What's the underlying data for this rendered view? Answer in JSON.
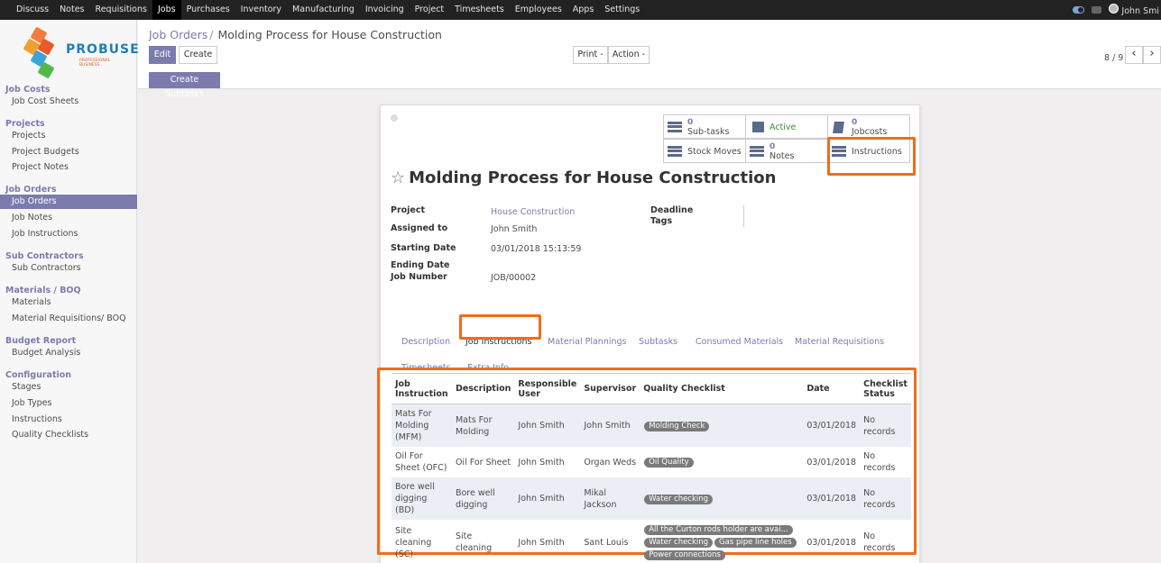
{
  "topnav": {
    "items": [
      "Discuss",
      "Notes",
      "Requisitions",
      "Jobs",
      "Purchases",
      "Inventory",
      "Manufacturing",
      "Invoicing",
      "Project",
      "Timesheets",
      "Employees",
      "Apps",
      "Settings"
    ],
    "active": "Jobs",
    "user": "John Smi"
  },
  "logo": {
    "name": "PROBUSE",
    "tagline": "PROFESSIONAL BUSINESS"
  },
  "sidebar": {
    "sections": [
      {
        "title": "Job Costs",
        "items": [
          "Job Cost Sheets"
        ]
      },
      {
        "title": "Projects",
        "items": [
          "Projects",
          "Project Budgets",
          "Project Notes"
        ]
      },
      {
        "title": "Job Orders",
        "items": [
          "Job Orders",
          "Job Notes",
          "Job Instructions"
        ]
      },
      {
        "title": "Sub Contractors",
        "items": [
          "Sub Contractors"
        ]
      },
      {
        "title": "Materials / BOQ",
        "items": [
          "Materials",
          "Material Requisitions/ BOQ"
        ]
      },
      {
        "title": "Budget Report",
        "items": [
          "Budget Analysis"
        ]
      },
      {
        "title": "Configuration",
        "items": [
          "Stages",
          "Job Types",
          "Instructions",
          "Quality Checklists"
        ]
      }
    ],
    "active_item": "Job Orders"
  },
  "breadcrumb": {
    "parent": "Job Orders",
    "sep": "/",
    "current": "Molding Process for House Construction"
  },
  "buttons": {
    "edit": "Edit",
    "create": "Create",
    "print": "Print -",
    "action": "Action -",
    "create_subtasks": "Create Subtasks"
  },
  "pager": {
    "text": "8 / 9",
    "prev": "‹",
    "next": "›"
  },
  "smart_buttons": {
    "subtasks": {
      "count": "0",
      "label": "Sub-tasks"
    },
    "active": {
      "label": "Active"
    },
    "jobcosts": {
      "count": "0",
      "label": "Jobcosts"
    },
    "stock_moves": {
      "label": "Stock Moves"
    },
    "notes": {
      "count": "0",
      "label": "Notes"
    },
    "instructions": {
      "label": "Instructions"
    }
  },
  "record": {
    "title": "Molding Process for House Construction",
    "fields": {
      "project_label": "Project",
      "project": "House Construction",
      "assigned_label": "Assigned to",
      "assigned": "John Smith",
      "start_label": "Starting Date",
      "start": "03/01/2018 15:13:59",
      "end_label": "Ending Date",
      "job_number_label": "Job Number",
      "job_number": "JOB/00002",
      "deadline_label": "Deadline",
      "tags_label": "Tags"
    }
  },
  "tabs": [
    "Description",
    "Job Instructions",
    "Material Plannings",
    "Subtasks",
    "Consumed Materials",
    "Material Requisitions",
    "Timesheets",
    "Extra Info"
  ],
  "active_tab": "Job Instructions",
  "table": {
    "headers": [
      "Job Instruction",
      "Description",
      "Responsible User",
      "Supervisor",
      "Quality Checklist",
      "Date",
      "Checklist Status"
    ],
    "rows": [
      {
        "instruction": "Mats For Molding (MFM)",
        "description": "Mats For Molding",
        "user": "John Smith",
        "supervisor": "John Smith",
        "checklist": [
          "Molding Check"
        ],
        "date": "03/01/2018",
        "status": "No records"
      },
      {
        "instruction": "Oil For Sheet (OFC)",
        "description": "Oil For Sheet",
        "user": "John Smith",
        "supervisor": "Organ Weds",
        "checklist": [
          "Oil Quality"
        ],
        "date": "03/01/2018",
        "status": "No records"
      },
      {
        "instruction": "Bore well digging (BD)",
        "description": "Bore well digging",
        "user": "John Smith",
        "supervisor": "Mikal Jackson",
        "checklist": [
          "Water checking"
        ],
        "date": "03/01/2018",
        "status": "No records"
      },
      {
        "instruction": "Site cleaning (SC)",
        "description": "Site cleaning",
        "user": "John Smith",
        "supervisor": "Sant Louis",
        "checklist": [
          "All the Curton rods holder are avai...",
          "Water checking",
          "Gas pipe line holes",
          "Power connections"
        ],
        "date": "03/01/2018",
        "status": "No records"
      }
    ]
  },
  "colors": {
    "brand": "#7c7bad",
    "highlight": "#f26b1d",
    "topbar": "#222222"
  }
}
